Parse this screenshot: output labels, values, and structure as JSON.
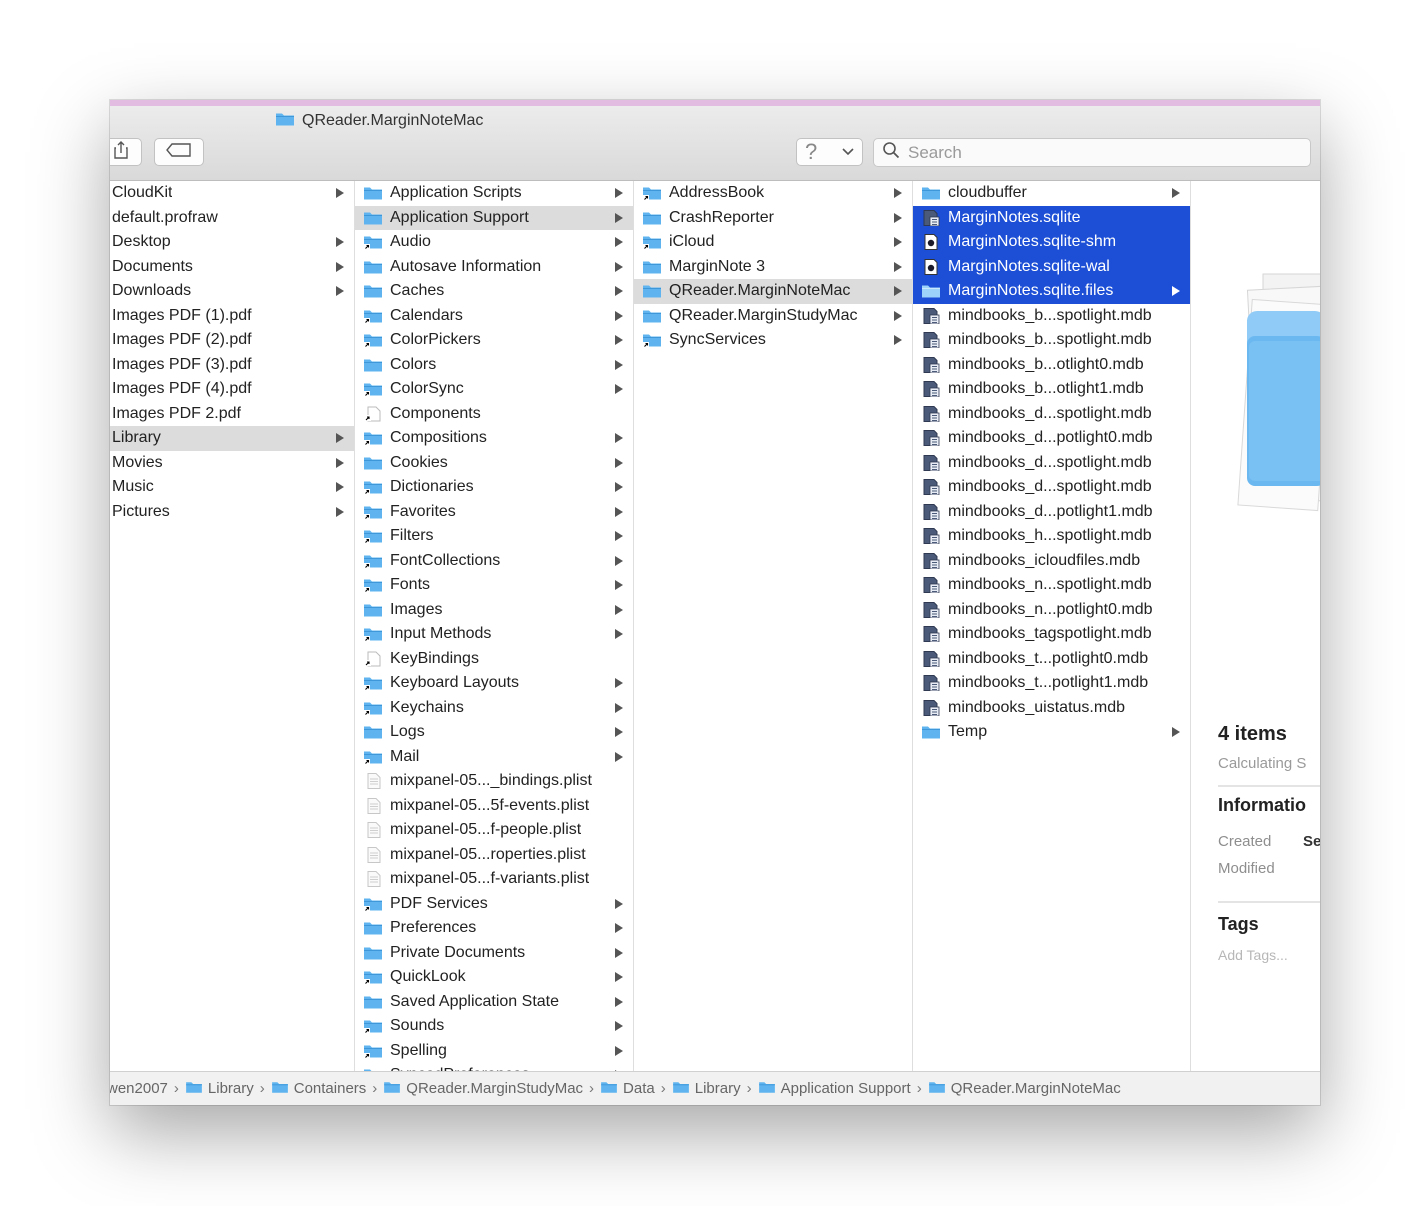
{
  "window": {
    "title": "QReader.MarginNoteMac"
  },
  "toolbar": {
    "help_label": "?",
    "search_placeholder": "Search"
  },
  "columns": [
    {
      "items": [
        {
          "label": "CloudKit",
          "type": "plain",
          "arrow": true
        },
        {
          "label": "default.profraw",
          "type": "plain",
          "arrow": false
        },
        {
          "label": "Desktop",
          "type": "plain",
          "arrow": true
        },
        {
          "label": "Documents",
          "type": "plain",
          "arrow": true
        },
        {
          "label": "Downloads",
          "type": "plain",
          "arrow": true
        },
        {
          "label": "Images PDF (1).pdf",
          "type": "plain",
          "arrow": false
        },
        {
          "label": "Images PDF (2).pdf",
          "type": "plain",
          "arrow": false
        },
        {
          "label": "Images PDF (3).pdf",
          "type": "plain",
          "arrow": false
        },
        {
          "label": "Images PDF (4).pdf",
          "type": "plain",
          "arrow": false
        },
        {
          "label": "Images PDF 2.pdf",
          "type": "plain",
          "arrow": false
        },
        {
          "label": "Library",
          "type": "plain",
          "arrow": true,
          "selected": "gray"
        },
        {
          "label": "Movies",
          "type": "plain",
          "arrow": true
        },
        {
          "label": "Music",
          "type": "plain",
          "arrow": true
        },
        {
          "label": "Pictures",
          "type": "plain",
          "arrow": true
        }
      ]
    },
    {
      "items": [
        {
          "label": "Application Scripts",
          "type": "folder",
          "arrow": true
        },
        {
          "label": "Application Support",
          "type": "folder",
          "arrow": true,
          "selected": "gray"
        },
        {
          "label": "Audio",
          "type": "alias",
          "arrow": true
        },
        {
          "label": "Autosave Information",
          "type": "folder",
          "arrow": true
        },
        {
          "label": "Caches",
          "type": "folder",
          "arrow": true
        },
        {
          "label": "Calendars",
          "type": "alias",
          "arrow": true
        },
        {
          "label": "ColorPickers",
          "type": "alias",
          "arrow": true
        },
        {
          "label": "Colors",
          "type": "folder",
          "arrow": true
        },
        {
          "label": "ColorSync",
          "type": "alias",
          "arrow": true
        },
        {
          "label": "Components",
          "type": "aliasfile",
          "arrow": false
        },
        {
          "label": "Compositions",
          "type": "alias",
          "arrow": true
        },
        {
          "label": "Cookies",
          "type": "folder",
          "arrow": true
        },
        {
          "label": "Dictionaries",
          "type": "alias",
          "arrow": true
        },
        {
          "label": "Favorites",
          "type": "alias",
          "arrow": true
        },
        {
          "label": "Filters",
          "type": "alias",
          "arrow": true
        },
        {
          "label": "FontCollections",
          "type": "alias",
          "arrow": true
        },
        {
          "label": "Fonts",
          "type": "alias",
          "arrow": true
        },
        {
          "label": "Images",
          "type": "folder",
          "arrow": true
        },
        {
          "label": "Input Methods",
          "type": "alias",
          "arrow": true
        },
        {
          "label": "KeyBindings",
          "type": "aliasfile",
          "arrow": false
        },
        {
          "label": "Keyboard Layouts",
          "type": "alias",
          "arrow": true
        },
        {
          "label": "Keychains",
          "type": "alias",
          "arrow": true
        },
        {
          "label": "Logs",
          "type": "folder",
          "arrow": true
        },
        {
          "label": "Mail",
          "type": "alias",
          "arrow": true
        },
        {
          "label": "mixpanel-05..._bindings.plist",
          "type": "plist",
          "arrow": false
        },
        {
          "label": "mixpanel-05...5f-events.plist",
          "type": "plist",
          "arrow": false
        },
        {
          "label": "mixpanel-05...f-people.plist",
          "type": "plist",
          "arrow": false
        },
        {
          "label": "mixpanel-05...roperties.plist",
          "type": "plist",
          "arrow": false
        },
        {
          "label": "mixpanel-05...f-variants.plist",
          "type": "plist",
          "arrow": false
        },
        {
          "label": "PDF Services",
          "type": "alias",
          "arrow": true
        },
        {
          "label": "Preferences",
          "type": "folder",
          "arrow": true
        },
        {
          "label": "Private Documents",
          "type": "folder",
          "arrow": true
        },
        {
          "label": "QuickLook",
          "type": "alias",
          "arrow": true
        },
        {
          "label": "Saved Application State",
          "type": "folder",
          "arrow": true
        },
        {
          "label": "Sounds",
          "type": "alias",
          "arrow": true
        },
        {
          "label": "Spelling",
          "type": "alias",
          "arrow": true
        },
        {
          "label": "SyncedPreferences",
          "type": "folder",
          "arrow": true
        }
      ]
    },
    {
      "items": [
        {
          "label": "AddressBook",
          "type": "alias",
          "arrow": true
        },
        {
          "label": "CrashReporter",
          "type": "folder",
          "arrow": true
        },
        {
          "label": "iCloud",
          "type": "alias",
          "arrow": true
        },
        {
          "label": "MarginNote 3",
          "type": "folder",
          "arrow": true
        },
        {
          "label": "QReader.MarginNoteMac",
          "type": "folder",
          "arrow": true,
          "selected": "gray"
        },
        {
          "label": "QReader.MarginStudyMac",
          "type": "folder",
          "arrow": true
        },
        {
          "label": "SyncServices",
          "type": "alias",
          "arrow": true
        }
      ]
    },
    {
      "items": [
        {
          "label": "cloudbuffer",
          "type": "folder",
          "arrow": true
        },
        {
          "label": "MarginNotes.sqlite",
          "type": "db",
          "arrow": false,
          "selected": "blue"
        },
        {
          "label": "MarginNotes.sqlite-shm",
          "type": "doc",
          "arrow": false,
          "selected": "blue"
        },
        {
          "label": "MarginNotes.sqlite-wal",
          "type": "doc",
          "arrow": false,
          "selected": "blue"
        },
        {
          "label": "MarginNotes.sqlite.files",
          "type": "folder",
          "arrow": true,
          "selected": "blue"
        },
        {
          "label": "mindbooks_b...spotlight.mdb",
          "type": "db",
          "arrow": false
        },
        {
          "label": "mindbooks_b...spotlight.mdb",
          "type": "db",
          "arrow": false
        },
        {
          "label": "mindbooks_b...otlight0.mdb",
          "type": "db",
          "arrow": false
        },
        {
          "label": "mindbooks_b...otlight1.mdb",
          "type": "db",
          "arrow": false
        },
        {
          "label": "mindbooks_d...spotlight.mdb",
          "type": "db",
          "arrow": false
        },
        {
          "label": "mindbooks_d...potlight0.mdb",
          "type": "db",
          "arrow": false
        },
        {
          "label": "mindbooks_d...spotlight.mdb",
          "type": "db",
          "arrow": false
        },
        {
          "label": "mindbooks_d...spotlight.mdb",
          "type": "db",
          "arrow": false
        },
        {
          "label": "mindbooks_d...potlight1.mdb",
          "type": "db",
          "arrow": false
        },
        {
          "label": "mindbooks_h...spotlight.mdb",
          "type": "db",
          "arrow": false
        },
        {
          "label": "mindbooks_icloudfiles.mdb",
          "type": "db",
          "arrow": false
        },
        {
          "label": "mindbooks_n...spotlight.mdb",
          "type": "db",
          "arrow": false
        },
        {
          "label": "mindbooks_n...potlight0.mdb",
          "type": "db",
          "arrow": false
        },
        {
          "label": "mindbooks_tagspotlight.mdb",
          "type": "db",
          "arrow": false
        },
        {
          "label": "mindbooks_t...potlight0.mdb",
          "type": "db",
          "arrow": false
        },
        {
          "label": "mindbooks_t...potlight1.mdb",
          "type": "db",
          "arrow": false
        },
        {
          "label": "mindbooks_uistatus.mdb",
          "type": "db",
          "arrow": false
        },
        {
          "label": "Temp",
          "type": "folder",
          "arrow": true
        }
      ]
    }
  ],
  "preview": {
    "count": "4 items",
    "calculating": "Calculating S",
    "info_heading": "Informatio",
    "created_label": "Created",
    "created_value": "Se",
    "modified_label": "Modified",
    "tags_heading": "Tags",
    "add_tags": "Add Tags..."
  },
  "pathbar": [
    {
      "label": "wen2007",
      "icon": false
    },
    {
      "label": "Library",
      "icon": true
    },
    {
      "label": "Containers",
      "icon": true
    },
    {
      "label": "QReader.MarginStudyMac",
      "icon": true
    },
    {
      "label": "Data",
      "icon": true
    },
    {
      "label": "Library",
      "icon": true
    },
    {
      "label": "Application Support",
      "icon": true
    },
    {
      "label": "QReader.MarginNoteMac",
      "icon": true
    }
  ],
  "colors": {
    "selection_blue": "#1c4fd6",
    "selection_gray": "#dcdcdc",
    "folder_blue": "#5fb4ef",
    "pink_bar": "#e2bde1"
  }
}
